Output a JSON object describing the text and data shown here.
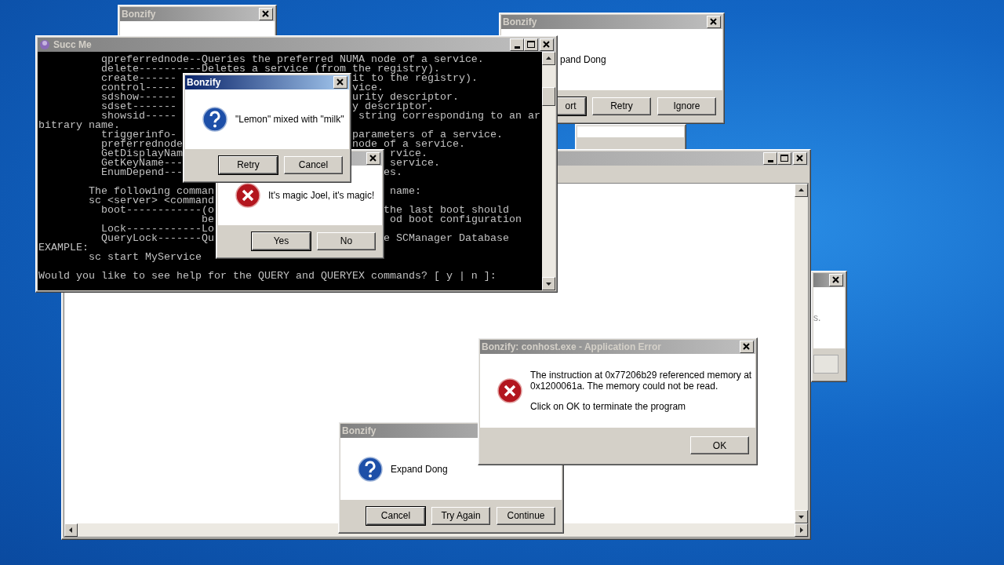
{
  "windows": [
    {
      "kind": "fragment",
      "title": "Bonzify",
      "active": false
    },
    {
      "kind": "fragment"
    },
    {
      "kind": "dialog",
      "title": "Bonzify",
      "active": false,
      "message": [
        "pand Dong"
      ],
      "buttons": [
        {
          "label": "ort",
          "default": true
        },
        {
          "label": "Retry",
          "default": false
        },
        {
          "label": "Ignore",
          "default": false
        }
      ]
    },
    {
      "kind": "fragment",
      "active": false,
      "message": [
        "s."
      ]
    },
    {
      "kind": "window",
      "active": false
    },
    {
      "kind": "console",
      "title": "Succ Me",
      "active": false,
      "lines": [
        {
          "text": "          qpreferrednode--Queries the preferred NUMA node of a service."
        },
        {
          "text": "          delete----------Deletes a service (from the registry)."
        },
        {
          "text": "          create------",
          "tail": "it to the registry)."
        },
        {
          "text": "          control-----",
          "tail": "vice."
        },
        {
          "text": "          sdshow------",
          "tail": "urity descriptor."
        },
        {
          "text": "          sdset-------",
          "tail": "y descriptor."
        },
        {
          "text": "          showsid-----",
          "tail": " string corresponding to an ar"
        },
        {
          "text": "bitrary name."
        },
        {
          "text": "          triggerinfo-",
          "tail": "parameters of a service."
        },
        {
          "text": "          preferrednode",
          "tail": "node of a service."
        },
        {
          "text": "          GetDisplayNam",
          "tail": " rvice."
        },
        {
          "text": "          GetKeyName---",
          "tail": " service."
        },
        {
          "text": "          EnumDepend---",
          "tail": "es."
        },
        {
          "text": "        The following comman",
          "tail": " name:",
          "blank_before": true
        },
        {
          "text": "        sc <server> <command"
        },
        {
          "text": "          boot------------(o",
          "tail": "the last boot should"
        },
        {
          "text": "                          be",
          "tail": " od boot configuration"
        },
        {
          "text": "          Lock------------Lo"
        },
        {
          "text": "          QueryLock-------Qu",
          "tail": "e SCManager Database"
        },
        {
          "text": "EXAMPLE:"
        },
        {
          "text": "        sc start MyService"
        },
        {
          "text": "Would you like to see help for the QUERY and QUERYEX commands? [ y | n ]:",
          "blank_before": true
        }
      ]
    },
    {
      "kind": "dialog",
      "title": "Bonzify",
      "active": false,
      "message": [
        "Expand Dong"
      ],
      "buttons": [
        {
          "label": "Cancel",
          "default": true
        },
        {
          "label": "Try Again",
          "default": false
        },
        {
          "label": "Continue",
          "default": false
        }
      ]
    },
    {
      "kind": "dialog",
      "active": false,
      "message": [
        "It's magic Joel, it's magic!"
      ],
      "buttons": [
        {
          "label": "Yes",
          "default": true
        },
        {
          "label": "No",
          "default": false
        }
      ]
    },
    {
      "kind": "dialog",
      "title": "Bonzify",
      "active": true,
      "message": [
        "\"Lemon\" mixed with \"milk\""
      ],
      "buttons": [
        {
          "label": "Retry",
          "default": true
        },
        {
          "label": "Cancel",
          "default": false
        }
      ]
    },
    {
      "kind": "dialog",
      "title": "Bonzify: conhost.exe - Application Error",
      "active": false,
      "message": [
        "The instruction at 0x77206b29 referenced memory at 0x1200061a. The memory could not be read.",
        "Click on OK to terminate the program"
      ],
      "buttons": [
        {
          "label": "OK",
          "default": false
        }
      ]
    }
  ]
}
